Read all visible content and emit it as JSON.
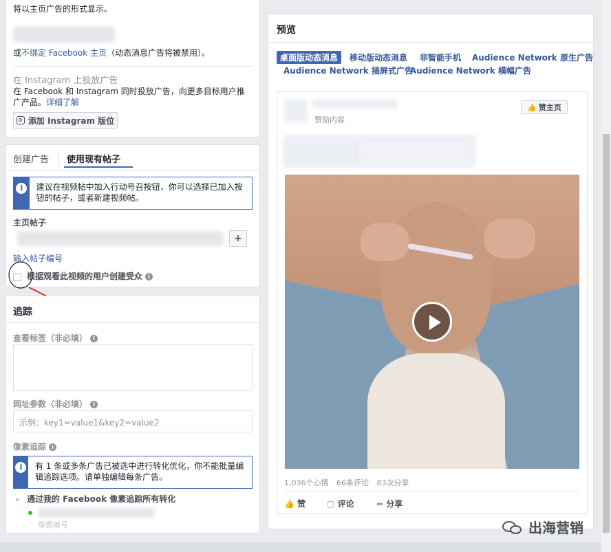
{
  "left": {
    "top_text": "将以主页广告的形式显示。",
    "unbind_prefix": "或",
    "unbind_link": "不绑定 Facebook 主页",
    "unbind_suffix": "（动态消息广告将被禁用）。",
    "instagram_title": "在 Instagram 上投放广告",
    "instagram_desc": "在 Facebook 和 Instagram 同时投放广告，向更多目标用户推广产品。",
    "learn_more": "详细了解",
    "add_instagram_btn": "添加 Instagram 版位",
    "tabs": [
      "创建广告",
      "使用现有帖子"
    ],
    "video_tip": "建议在视频帖中加入行动号召按钮，你可以选择已加入按钮的帖子，或者新建视频帖。",
    "page_post_label": "主页帖子",
    "plus": "+",
    "enter_post_id": "输入帖子编号",
    "checkbox_label": "根据观看此视频的用户创建受众",
    "tracking_title": "追踪",
    "view_tags_label": "查看标签（非必填）",
    "url_params_label": "网址参数（非必填）",
    "url_params_placeholder": "示例：key1=value1&key2=value2",
    "pixel_label": "像素追踪",
    "pixel_tip": "有 1 条或多条广告已被选中进行转化优化，你不能批量编辑追踪选项。请单独编辑每条广告。",
    "pixel_all": "通过我的 Facebook 像素追踪所有转化",
    "pixel_item": "像素编号"
  },
  "preview": {
    "title": "预览",
    "tabs": [
      "桌面版动态消息",
      "移动版动态消息",
      "非智能手机",
      "Audience Network 原生广告",
      "Audience Network 插屏式广告",
      "Audience Network 横幅广告"
    ],
    "like_page_btn": "赞主页",
    "sponsored": "赞助内容",
    "stats": {
      "reactions": "1,036个心情",
      "comments": "66条评论",
      "shares": "83次分享"
    },
    "actions": [
      "赞",
      "评论",
      "分享"
    ]
  },
  "watermark": "出海营销",
  "colors": {
    "accent": "#4267b2",
    "link": "#365899",
    "arrow": "#e0262b"
  }
}
